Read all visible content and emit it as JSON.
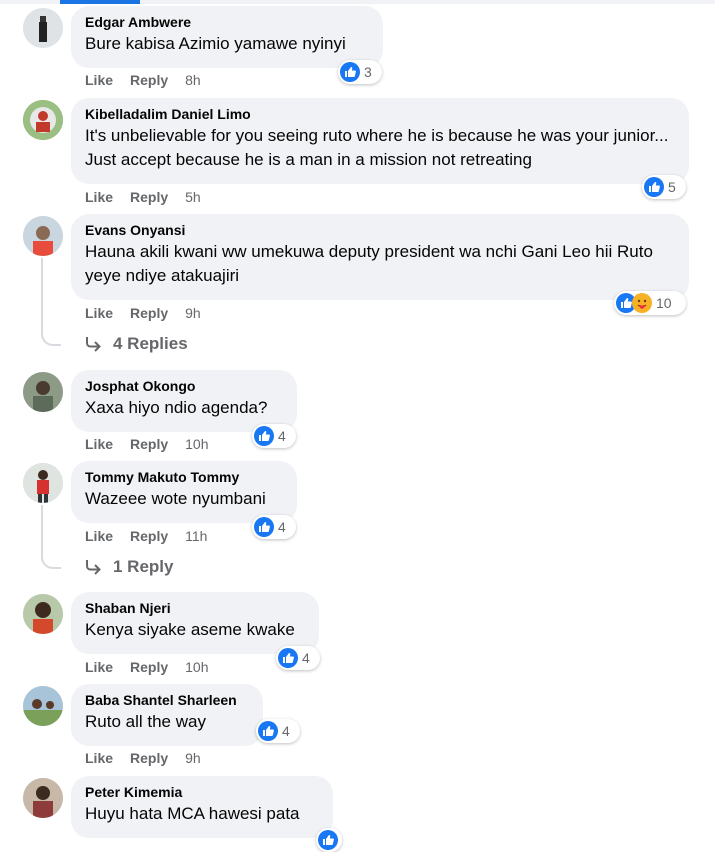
{
  "actions": {
    "like": "Like",
    "reply": "Reply"
  },
  "comments": [
    {
      "author": "Edgar Ambwere",
      "text": "Bure kabisa Azimio yamawe nyinyi",
      "time": "8h",
      "reactions": "3",
      "reaction_icons": [
        "like-icon"
      ]
    },
    {
      "author": "Kibelladalim Daniel Limo",
      "text": "It's unbelievable for you seeing ruto where he is because he was your junior... Just accept because he is a man in a mission not retreating",
      "time": "5h",
      "reactions": "5",
      "reaction_icons": [
        "like-icon"
      ]
    },
    {
      "author": "Evans Onyansi",
      "text": "Hauna akili kwani ww umekuwa deputy president wa nchi Gani Leo hii Ruto yeye ndiye atakuajiri",
      "time": "9h",
      "reactions": "10",
      "reaction_icons": [
        "like-icon",
        "care-icon"
      ],
      "replies": "4 Replies"
    },
    {
      "author": "Josphat Okongo",
      "text": "Xaxa hiyo ndio agenda?",
      "time": "10h",
      "reactions": "4",
      "reaction_icons": [
        "like-icon"
      ]
    },
    {
      "author": "Tommy Makuto Tommy",
      "text": "Wazeee wote nyumbani",
      "time": "11h",
      "reactions": "4",
      "reaction_icons": [
        "like-icon"
      ],
      "replies": "1 Reply"
    },
    {
      "author": "Shaban Njeri",
      "text": "Kenya siyake aseme kwake",
      "time": "10h",
      "reactions": "4",
      "reaction_icons": [
        "like-icon"
      ]
    },
    {
      "author": "Baba Shantel Sharleen",
      "text": "Ruto all the way",
      "time": "9h",
      "reactions": "4",
      "reaction_icons": [
        "like-icon"
      ]
    },
    {
      "author": "Peter Kimemia",
      "text": "Huyu hata MCA hawesi pata",
      "time": "",
      "reactions": "",
      "reaction_icons": [
        "like-icon"
      ]
    }
  ],
  "colors": {
    "bubble": "#f0f2f5",
    "like": "#1877f2",
    "meta": "#65676b"
  }
}
